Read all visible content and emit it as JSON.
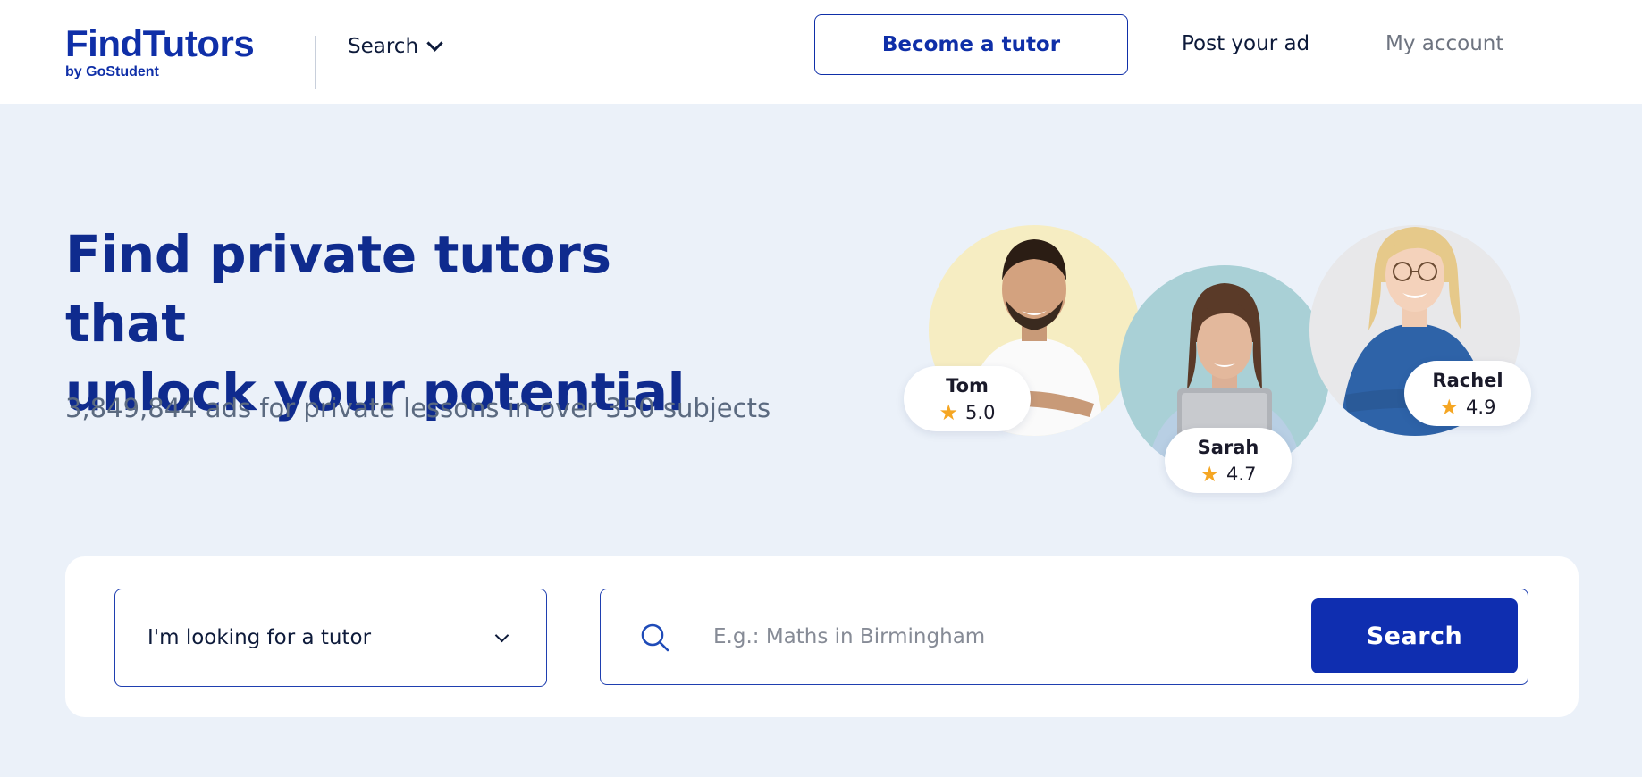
{
  "header": {
    "logo_main": "FindTutors",
    "logo_sub": "by GoStudent",
    "nav_search_label": "Search",
    "become_tutor_label": "Become a tutor",
    "post_ad_label": "Post your ad",
    "my_account_label": "My account"
  },
  "hero": {
    "title_line1": "Find private tutors that",
    "title_line2": "unlock your potential",
    "subtitle": "3,849,844 ads for private lessons in over 350 subjects"
  },
  "tutors": [
    {
      "name": "Tom",
      "rating": "5.0",
      "bg_color": "#f6edc2"
    },
    {
      "name": "Sarah",
      "rating": "4.7",
      "bg_color": "#a9d0d6"
    },
    {
      "name": "Rachel",
      "rating": "4.9",
      "bg_color": "#e8e8ea"
    }
  ],
  "search": {
    "select_value": "I'm looking for a tutor",
    "input_placeholder": "E.g.: Maths in Birmingham",
    "button_label": "Search"
  },
  "colors": {
    "brand_blue": "#0f2fa8",
    "page_background": "#ebf1f9",
    "star": "#f5a623"
  }
}
